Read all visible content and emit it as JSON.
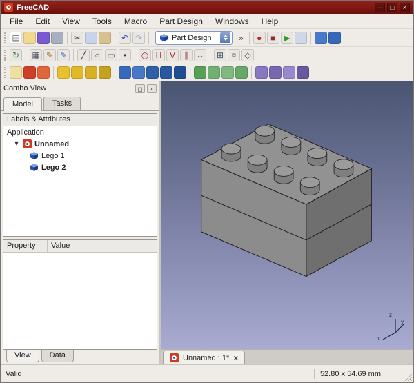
{
  "window": {
    "title": "FreeCAD",
    "controls": [
      {
        "name": "minimize",
        "glyph": "–"
      },
      {
        "name": "maximize",
        "glyph": "□"
      },
      {
        "name": "close",
        "glyph": "×"
      }
    ]
  },
  "menu": {
    "items": [
      "File",
      "Edit",
      "View",
      "Tools",
      "Macro",
      "Part Design",
      "Windows",
      "Help"
    ]
  },
  "toolbar1": {
    "workbench_selector": "Part Design",
    "overflow": "»",
    "icons_left": [
      {
        "n": "new-file",
        "g": "▤",
        "fg": "#667",
        "bg": "#fdfdfd"
      },
      {
        "n": "open-folder",
        "bg": "#f0d890"
      },
      {
        "n": "save",
        "bg": "#7a5ad0"
      },
      {
        "n": "print",
        "bg": "#a8b0c0"
      },
      {
        "sep": true
      },
      {
        "n": "cut",
        "g": "✂",
        "fg": "#445"
      },
      {
        "n": "copy",
        "bg": "#c8d4ec"
      },
      {
        "n": "paste",
        "bg": "#d8c090"
      },
      {
        "sep": true
      },
      {
        "n": "undo",
        "g": "↶",
        "fg": "#2858c8"
      },
      {
        "n": "redo",
        "g": "↷",
        "fg": "#98b0e0"
      },
      {
        "sep": true
      }
    ],
    "icons_right": [
      {
        "n": "macro-record",
        "g": "●",
        "fg": "#c82020"
      },
      {
        "n": "macro-stop",
        "g": "■",
        "fg": "#883030"
      },
      {
        "n": "macro-play",
        "g": "▶",
        "fg": "#28a028"
      },
      {
        "n": "macro-edit",
        "bg": "#d0d8e8"
      },
      {
        "sep": true
      },
      {
        "n": "part-box",
        "bg": "#4878c8"
      },
      {
        "n": "part-cylinder",
        "bg": "#3868b8"
      }
    ]
  },
  "toolbar2": {
    "icons": [
      {
        "n": "refresh",
        "g": "↻",
        "fg": "#3a8a3a"
      },
      {
        "sep": true
      },
      {
        "n": "select-box",
        "g": "▦",
        "fg": "#556"
      },
      {
        "n": "new-sketch",
        "g": "✎",
        "fg": "#b06020"
      },
      {
        "n": "edit-sketch",
        "g": "✎",
        "fg": "#4070c0"
      },
      {
        "sep": true
      },
      {
        "n": "line",
        "g": "╱",
        "fg": "#335"
      },
      {
        "n": "circle",
        "g": "○",
        "fg": "#335"
      },
      {
        "n": "rectangle",
        "g": "▭",
        "fg": "#335"
      },
      {
        "n": "point",
        "g": "•",
        "fg": "#335"
      },
      {
        "sep": true
      },
      {
        "n": "constraint-coincident",
        "g": "◎",
        "fg": "#a03030"
      },
      {
        "n": "constraint-horizontal",
        "g": "H",
        "fg": "#a03030"
      },
      {
        "n": "constraint-vertical",
        "g": "V",
        "fg": "#a03030"
      },
      {
        "n": "constraint-parallel",
        "g": "∥",
        "fg": "#a03030"
      },
      {
        "n": "dimension",
        "g": "↔",
        "fg": "#803030"
      },
      {
        "sep": true
      },
      {
        "n": "grid",
        "g": "⊞",
        "fg": "#456"
      },
      {
        "n": "snap",
        "g": "¤",
        "fg": "#456"
      },
      {
        "n": "close-shape",
        "g": "◇",
        "fg": "#456"
      }
    ]
  },
  "toolbar3": {
    "icons": [
      {
        "n": "create-body",
        "bg": "#f0e0a0"
      },
      {
        "n": "create-sketch",
        "bg": "#d04028"
      },
      {
        "n": "map-sketch",
        "bg": "#e06838"
      },
      {
        "sep": true
      },
      {
        "n": "pad",
        "bg": "#e8c030"
      },
      {
        "n": "revolution",
        "bg": "#e0b828"
      },
      {
        "n": "additive-loft",
        "bg": "#d8b028"
      },
      {
        "n": "additive-pipe",
        "bg": "#c8a020"
      },
      {
        "sep": true
      },
      {
        "n": "pocket",
        "bg": "#3868b8"
      },
      {
        "n": "hole",
        "bg": "#4878c8"
      },
      {
        "n": "groove",
        "bg": "#3060a8"
      },
      {
        "n": "subtractive-loft",
        "bg": "#2858a0"
      },
      {
        "n": "subtractive-pipe",
        "bg": "#204e90"
      },
      {
        "sep": true
      },
      {
        "n": "fillet",
        "bg": "#58a058"
      },
      {
        "n": "chamfer",
        "bg": "#70b070"
      },
      {
        "n": "draft",
        "bg": "#80b880"
      },
      {
        "n": "thickness",
        "bg": "#68a868"
      },
      {
        "sep": true
      },
      {
        "n": "mirrored",
        "bg": "#8878c0"
      },
      {
        "n": "linear-pattern",
        "bg": "#7868b0"
      },
      {
        "n": "polar-pattern",
        "bg": "#9888d0"
      },
      {
        "n": "multitransform",
        "bg": "#6858a0"
      }
    ]
  },
  "combo_view": {
    "title": "Combo View",
    "float_glyph": "◻",
    "close_glyph": "×",
    "expander_glyph": "▾",
    "tabs": [
      {
        "label": "Model",
        "active": true
      },
      {
        "label": "Tasks",
        "active": false
      }
    ],
    "tree_header": "Labels & Attributes",
    "tree": {
      "root": "Application",
      "document": "Unnamed",
      "items": [
        {
          "label": "Lego 1",
          "bold": false
        },
        {
          "label": "Lego 2",
          "bold": true
        }
      ]
    },
    "property_table": {
      "headers": [
        "Property",
        "Value"
      ]
    },
    "bottom_tabs": [
      {
        "label": "View",
        "active": true
      },
      {
        "label": "Data",
        "active": false
      }
    ]
  },
  "viewport": {
    "mdi_tab_label": "Unnamed : 1*",
    "mdi_tab_close": "×",
    "model": "two stacked gray LEGO 2x4 bricks, isometric view",
    "gradient_top": "#4a5572",
    "gradient_bottom": "#a9abd1",
    "axis_labels": {
      "x": "x",
      "y": "y",
      "z": "z"
    }
  },
  "status_bar": {
    "left": "Valid",
    "right": "52.80 x 54.69 mm"
  }
}
